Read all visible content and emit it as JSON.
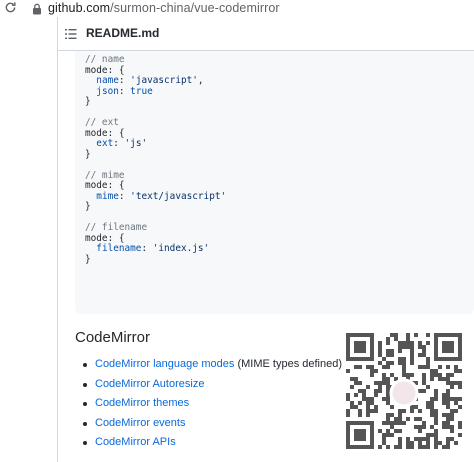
{
  "browser": {
    "url_host": "github.com",
    "url_path": "/surmon-china/vue-codemirror"
  },
  "file": {
    "name": "README.md"
  },
  "code_lines": [
    [
      {
        "t": "// name",
        "c": "cm"
      }
    ],
    [
      {
        "t": "mode: {",
        "c": ""
      }
    ],
    [
      {
        "t": "  ",
        "c": ""
      },
      {
        "t": "name",
        "c": "key"
      },
      {
        "t": ": ",
        "c": ""
      },
      {
        "t": "'javascript'",
        "c": "str"
      },
      {
        "t": ",",
        "c": ""
      }
    ],
    [
      {
        "t": "  ",
        "c": ""
      },
      {
        "t": "json",
        "c": "key"
      },
      {
        "t": ": ",
        "c": ""
      },
      {
        "t": "true",
        "c": "bool"
      }
    ],
    [
      {
        "t": "}",
        "c": ""
      }
    ],
    [
      {
        "t": "",
        "c": ""
      }
    ],
    [
      {
        "t": "// ext",
        "c": "cm"
      }
    ],
    [
      {
        "t": "mode: {",
        "c": ""
      }
    ],
    [
      {
        "t": "  ",
        "c": ""
      },
      {
        "t": "ext",
        "c": "key"
      },
      {
        "t": ": ",
        "c": ""
      },
      {
        "t": "'js'",
        "c": "str"
      }
    ],
    [
      {
        "t": "}",
        "c": ""
      }
    ],
    [
      {
        "t": "",
        "c": ""
      }
    ],
    [
      {
        "t": "// mime",
        "c": "cm"
      }
    ],
    [
      {
        "t": "mode: {",
        "c": ""
      }
    ],
    [
      {
        "t": "  ",
        "c": ""
      },
      {
        "t": "mime",
        "c": "key"
      },
      {
        "t": ": ",
        "c": ""
      },
      {
        "t": "'text/javascript'",
        "c": "str"
      }
    ],
    [
      {
        "t": "}",
        "c": ""
      }
    ],
    [
      {
        "t": "",
        "c": ""
      }
    ],
    [
      {
        "t": "// filename",
        "c": "cm"
      }
    ],
    [
      {
        "t": "mode: {",
        "c": ""
      }
    ],
    [
      {
        "t": "  ",
        "c": ""
      },
      {
        "t": "filename",
        "c": "key"
      },
      {
        "t": ": ",
        "c": ""
      },
      {
        "t": "'index.js'",
        "c": "str"
      }
    ],
    [
      {
        "t": "}",
        "c": ""
      }
    ]
  ],
  "section": {
    "heading": "CodeMirror",
    "links": [
      {
        "label": "CodeMirror language modes",
        "suffix": " (MIME types defined)"
      },
      {
        "label": "CodeMirror Autoresize",
        "suffix": ""
      },
      {
        "label": "CodeMirror themes",
        "suffix": ""
      },
      {
        "label": "CodeMirror events",
        "suffix": ""
      },
      {
        "label": "CodeMirror APIs",
        "suffix": ""
      }
    ]
  },
  "colors": {
    "link": "#0969da",
    "code_bg": "#f6f8fa",
    "comment": "#6e7781",
    "string": "#0a3069",
    "keyword": "#0550ae"
  },
  "icons": {
    "reload": "reload-icon",
    "lock": "lock-icon",
    "toc": "list-icon",
    "qr": "qr-code-image"
  }
}
